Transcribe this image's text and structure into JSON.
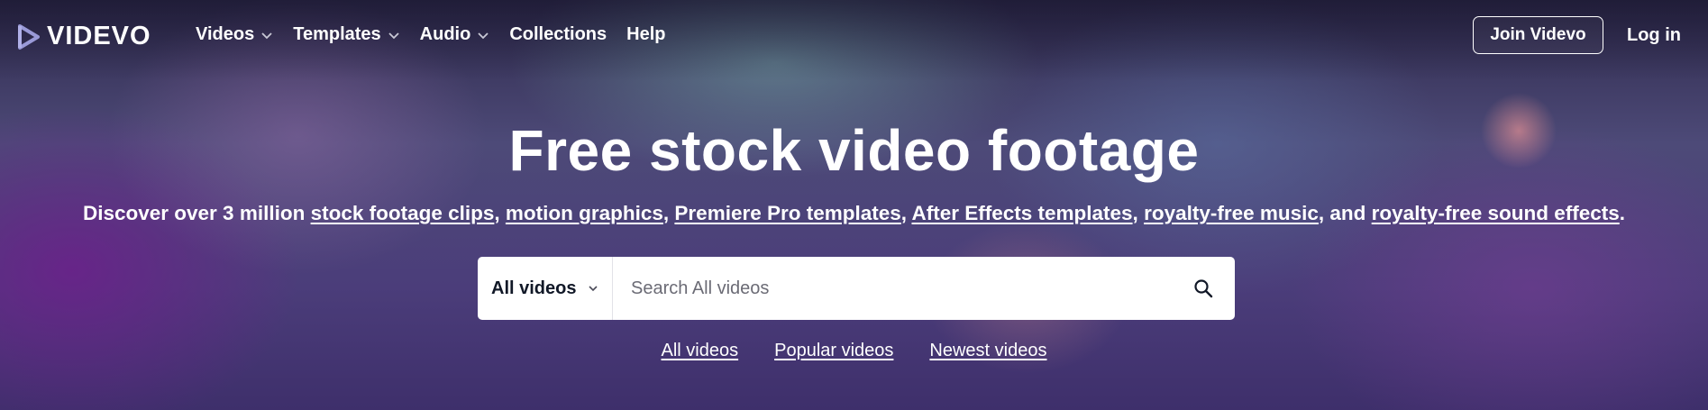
{
  "brand": {
    "name": "VIDEVO"
  },
  "nav": {
    "items": [
      {
        "label": "Videos",
        "has_dropdown": true
      },
      {
        "label": "Templates",
        "has_dropdown": true
      },
      {
        "label": "Audio",
        "has_dropdown": true
      },
      {
        "label": "Collections",
        "has_dropdown": false
      },
      {
        "label": "Help",
        "has_dropdown": false
      }
    ],
    "join_label": "Join Videvo",
    "login_label": "Log in"
  },
  "hero": {
    "title": "Free stock video footage",
    "subtitle": {
      "prefix": "Discover over 3 million ",
      "links": [
        "stock footage clips",
        "motion graphics",
        "Premiere Pro templates",
        "After Effects templates",
        "royalty-free music",
        "royalty-free sound effects"
      ],
      "separator": ", ",
      "conjunction": ", and ",
      "suffix": "."
    }
  },
  "search": {
    "type_label": "All videos",
    "placeholder": "Search All videos",
    "value": "",
    "icon": "search-icon"
  },
  "quick_links": [
    "All videos",
    "Popular videos",
    "Newest videos"
  ],
  "colors": {
    "text": "#ffffff",
    "search_bg": "#ffffff",
    "dark_text": "#111827"
  }
}
